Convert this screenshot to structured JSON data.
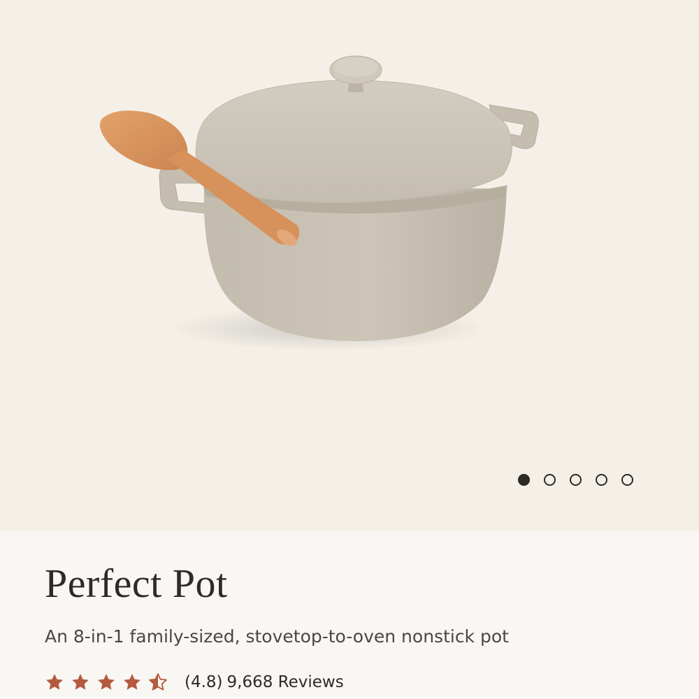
{
  "product": {
    "title": "Perfect Pot",
    "subtitle": "An 8-in-1 family-sized, stovetop-to-oven nonstick pot",
    "rating_value": "(4.8)",
    "review_count": "9,668 Reviews",
    "rating_stars": 4.5
  },
  "gallery": {
    "total_images": 5,
    "active_index": 0
  },
  "colors": {
    "hero_bg": "#f4f0e8",
    "page_bg": "#f9f7f3",
    "text_primary": "#2d2a27",
    "text_secondary": "#4a4643",
    "star": "#b55a3e",
    "pot": "#c9c2b5"
  },
  "icons": {
    "star": "star-icon",
    "star_half": "star-half-icon",
    "dot": "carousel-dot"
  }
}
